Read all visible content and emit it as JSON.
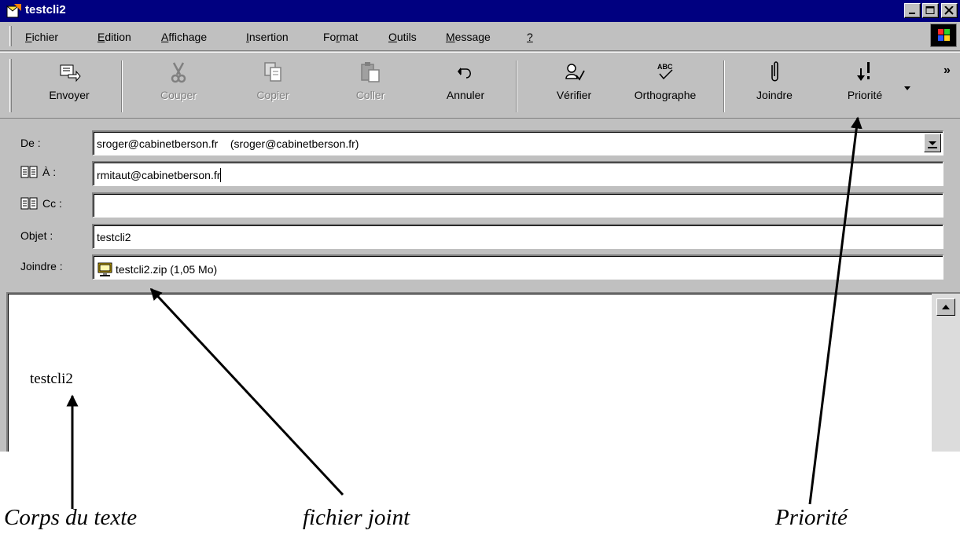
{
  "window": {
    "title": "testcli2"
  },
  "menu": {
    "items": [
      {
        "pre": "",
        "acc": "F",
        "post": "ichier"
      },
      {
        "pre": "",
        "acc": "E",
        "post": "dition"
      },
      {
        "pre": "",
        "acc": "A",
        "post": "ffichage"
      },
      {
        "pre": "",
        "acc": "I",
        "post": "nsertion"
      },
      {
        "pre": "Fo",
        "acc": "r",
        "post": "mat"
      },
      {
        "pre": "",
        "acc": "O",
        "post": "utils"
      },
      {
        "pre": "",
        "acc": "M",
        "post": "essage"
      },
      {
        "pre": "",
        "acc": "?",
        "post": ""
      }
    ]
  },
  "toolbar": {
    "send": "Envoyer",
    "cut": "Couper",
    "copy": "Copier",
    "paste": "Coller",
    "undo": "Annuler",
    "check": "Vérifier",
    "spelling": "Orthographe",
    "attach": "Joindre",
    "priority": "Priorité",
    "overflow": "»"
  },
  "header": {
    "from_label": "De :",
    "from_value": "sroger@cabinetberson.fr    (sroger@cabinetberson.fr)",
    "to_label": "À :",
    "to_value": "rmitaut@cabinetberson.fr",
    "cc_label": "Cc :",
    "cc_value": "",
    "subject_label": "Objet :",
    "subject_value": "testcli2",
    "attach_label": "Joindre :",
    "attach_value": "testcli2.zip (1,05 Mo)"
  },
  "body": {
    "text": "testcli2"
  },
  "annotations": {
    "body_caption": "Corps du texte",
    "attachment_caption": "fichier joint",
    "priority_caption": "Priorité"
  }
}
